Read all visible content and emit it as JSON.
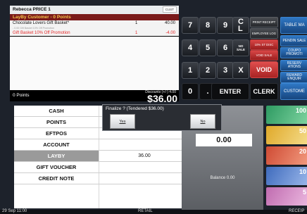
{
  "receipt": {
    "operator": "Rebecca PRICE 1",
    "cust_button": "CUST",
    "customer_line": "LayBy Customer  -  0 Points",
    "items": [
      {
        "name": "Chocolate Lovers Gift Basket*",
        "qty": "1",
        "price": "40.00"
      },
      {
        "name": "- 0.00 Gift Basket 10% Off Promotion",
        "qty": "",
        "price": ""
      },
      {
        "name": "Gift Basket 10% Off Promotion",
        "qty": "1",
        "price": "-4.00"
      }
    ],
    "points": "0 Points",
    "discount_label": "Discounts (+/-)   4.00",
    "total": "$36.00"
  },
  "keypad": {
    "row1": [
      "7",
      "8",
      "9"
    ],
    "row2": [
      "4",
      "5",
      "6"
    ],
    "row3": [
      "1",
      "2",
      "3"
    ],
    "clear": "C\nL",
    "no_sale": "NO\nSALE",
    "x": "X",
    "zero": "0",
    "dot": ".",
    "enter": "ENTER",
    "clerk": "CLERK"
  },
  "functions": {
    "print_receipt": "PRINT RECEIPT",
    "employee_log": "EMPLOYEE LOG",
    "pct_disc": "10% ST DISC",
    "void_sale": "VOID SALE",
    "void": "VOID"
  },
  "side_buttons": {
    "table_map": "TABLE MA",
    "pending_sale": "PENDIN SALE",
    "coupon_promo": "COUPO PROMOTI",
    "reservations": "RESERV ATIONS",
    "reward_enquiry": "REWARD ENQUIR",
    "customer": "CUSTOME"
  },
  "tenders": [
    {
      "label": "CASH",
      "value": ""
    },
    {
      "label": "POINTS",
      "value": ""
    },
    {
      "label": "EFTPOS",
      "value": ""
    },
    {
      "label": "ACCOUNT",
      "value": ""
    },
    {
      "label": "LAYBY",
      "value": "36.00"
    },
    {
      "label": "GIFT VOUCHER",
      "value": ""
    },
    {
      "label": "CREDIT NOTE",
      "value": ""
    }
  ],
  "tender_panel": {
    "amount": "0.00",
    "balance": "Balance 0.00"
  },
  "notes": [
    {
      "label": "100",
      "color": "#2e9a62"
    },
    {
      "label": "50",
      "color": "#e0a92a"
    },
    {
      "label": "20",
      "color": "#cf4b34"
    },
    {
      "label": "10",
      "color": "#3f6bbd"
    },
    {
      "label": "5",
      "color": "#c06cb0"
    }
  ],
  "dialog": {
    "message": "Finalize ?   (Tendered  $36.00)",
    "yes": "Yes",
    "no": "No"
  },
  "status": {
    "date": "29 Sep 11:00",
    "mode": "RETAIL",
    "right": "RECEIP"
  }
}
